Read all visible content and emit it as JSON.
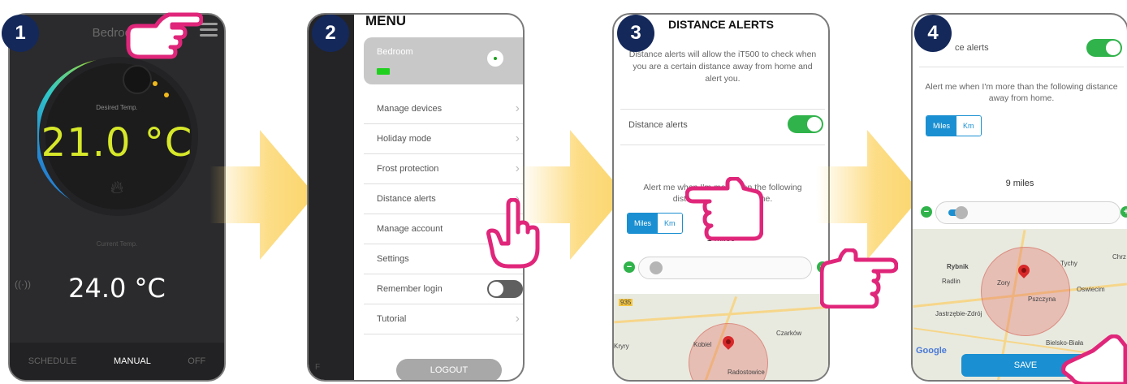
{
  "steps": [
    "1",
    "2",
    "3",
    "4"
  ],
  "screen1": {
    "title": "Bedroom",
    "desired_label": "Desired Temp.",
    "setpoint": "21.0 °C",
    "current_label": "Current Temp.",
    "current": "24.0 °C",
    "tabs": [
      "SCHEDULE",
      "MANUAL",
      "OFF"
    ],
    "active_tab": "MANUAL",
    "icons": [
      "menu-icon",
      "flame-icon",
      "signal-icon"
    ]
  },
  "screen2": {
    "menu_title": "MENU",
    "device_name": "Bedroom",
    "items": [
      "Manage devices",
      "Holiday mode",
      "Frost protection",
      "Distance alerts",
      "Manage account",
      "Settings",
      "Remember login",
      "Tutorial"
    ],
    "remember_login": false,
    "logout": "LOGOUT",
    "underlay_text": "F"
  },
  "screen3": {
    "title": "DISTANCE ALERTS",
    "description": "Distance alerts will allow the iT500 to check when you are a certain distance away from home and alert you.",
    "toggle_label": "Distance alerts",
    "toggle_on": true,
    "alert_text": "Alert me when I'm more than the following distance away from home.",
    "units": [
      "Miles",
      "Km"
    ],
    "selected_unit": "Miles",
    "distance": "1 miles",
    "map_labels": [
      "Kobiel",
      "Czarków",
      "Radostowice",
      "Kryry",
      "935"
    ]
  },
  "screen4": {
    "toggle_label": "ce alerts",
    "toggle_on": true,
    "alert_text": "Alert me when I'm more than the following distance away from home.",
    "units": [
      "Miles",
      "Km"
    ],
    "selected_unit": "Miles",
    "distance": "9 miles",
    "map_labels": [
      "Rybnik",
      "Radlin",
      "Zory",
      "Tychy",
      "Chrz",
      "Oswiecim",
      "Pszczyna",
      "Jastrzębie-Zdrój",
      "Bielsko-Biała",
      "Google"
    ],
    "save": "SAVE"
  },
  "colors": {
    "badge": "#14285a",
    "accent_blue": "#1a8fd1",
    "toggle_green": "#2fb34a",
    "hand_pink": "#e0267a",
    "arrow_yellow": "#fcd56a"
  }
}
